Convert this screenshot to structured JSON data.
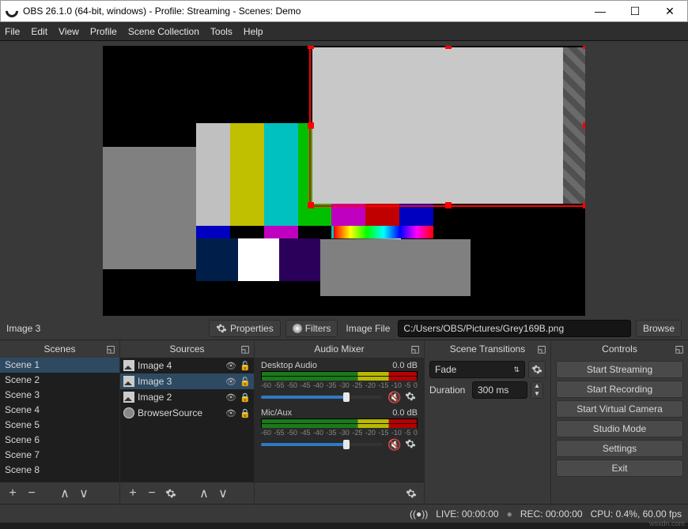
{
  "window": {
    "title": "OBS 26.1.0 (64-bit, windows) - Profile: Streaming - Scenes: Demo"
  },
  "menu": [
    "File",
    "Edit",
    "View",
    "Profile",
    "Scene Collection",
    "Tools",
    "Help"
  ],
  "selected_source_label": "Image 3",
  "context": {
    "properties": "Properties",
    "filters": "Filters",
    "file_label": "Image File",
    "file_path": "C:/Users/OBS/Pictures/Grey169B.png",
    "browse": "Browse"
  },
  "panels": {
    "scenes": {
      "title": "Scenes",
      "items": [
        "Scene 1",
        "Scene 2",
        "Scene 3",
        "Scene 4",
        "Scene 5",
        "Scene 6",
        "Scene 7",
        "Scene 8"
      ],
      "active_index": 0
    },
    "sources": {
      "title": "Sources",
      "items": [
        {
          "icon": "img",
          "label": "Image 4",
          "visible": true,
          "locked": false
        },
        {
          "icon": "img",
          "label": "Image 3",
          "visible": true,
          "locked": false
        },
        {
          "icon": "img",
          "label": "Image 2",
          "visible": true,
          "locked": true
        },
        {
          "icon": "browser",
          "label": "BrowserSource",
          "visible": true,
          "locked": true
        }
      ],
      "active_index": 1
    },
    "mixer": {
      "title": "Audio Mixer",
      "channels": [
        {
          "name": "Desktop Audio",
          "db": "0.0 dB",
          "ticks": [
            "-60",
            "-55",
            "-50",
            "-45",
            "-40",
            "-35",
            "-30",
            "-25",
            "-20",
            "-15",
            "-10",
            "-5",
            "0"
          ]
        },
        {
          "name": "Mic/Aux",
          "db": "0.0 dB",
          "ticks": [
            "-60",
            "-55",
            "-50",
            "-45",
            "-40",
            "-35",
            "-30",
            "-25",
            "-20",
            "-15",
            "-10",
            "-5",
            "0"
          ]
        }
      ]
    },
    "transitions": {
      "title": "Scene Transitions",
      "mode": "Fade",
      "duration_label": "Duration",
      "duration_value": "300 ms"
    },
    "controls": {
      "title": "Controls",
      "buttons": [
        "Start Streaming",
        "Start Recording",
        "Start Virtual Camera",
        "Studio Mode",
        "Settings",
        "Exit"
      ]
    }
  },
  "status": {
    "live_label": "LIVE:",
    "live_time": "00:00:00",
    "rec_label": "REC:",
    "rec_time": "00:00:00",
    "cpu": "CPU: 0.4%, 60.00 fps"
  },
  "watermark": "wsxdn.com"
}
